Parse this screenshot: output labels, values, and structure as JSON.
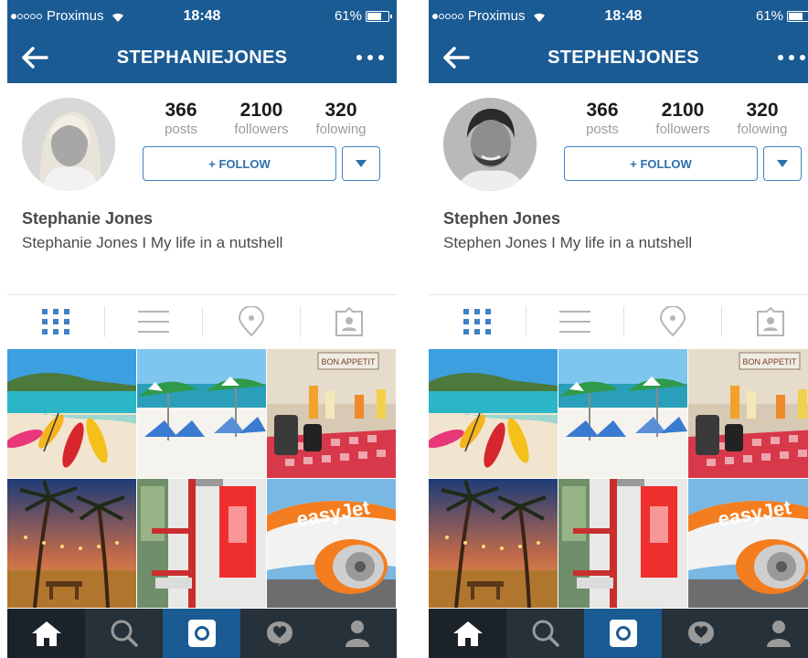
{
  "status_bar": {
    "carrier": "Proximus",
    "time": "18:48",
    "battery": "61%",
    "battery_level": 0.61
  },
  "colors": {
    "brand_blue": "#1b5b94",
    "accent_blue": "#3d82c4",
    "bottom_bar": "#26313a"
  },
  "profiles": [
    {
      "username": "STEPHANIEJONES",
      "stats": [
        {
          "value": "366",
          "label": "posts"
        },
        {
          "value": "2100",
          "label": "followers"
        },
        {
          "value": "320",
          "label": "folowing"
        }
      ],
      "follow_label": "+ FOLLOW",
      "full_name": "Stephanie Jones",
      "bio": "Stephanie Jones I My life in a nutshell",
      "avatar": "female-portrait"
    },
    {
      "username": "STEPHENJONES",
      "stats": [
        {
          "value": "366",
          "label": "posts"
        },
        {
          "value": "2100",
          "label": "followers"
        },
        {
          "value": "320",
          "label": "folowing"
        }
      ],
      "follow_label": "+ FOLLOW",
      "full_name": "Stephen Jones",
      "bio": "Stephen Jones I My life in a nutshell",
      "avatar": "male-portrait"
    }
  ],
  "profile_tabs": [
    "grid-icon",
    "list-icon",
    "location-pin-icon",
    "tagged-photo-icon"
  ],
  "photo_grid": [
    {
      "subject": "beach-kayaks-photo",
      "text": ""
    },
    {
      "subject": "beach-umbrellas-photo",
      "text": ""
    },
    {
      "subject": "breakfast-buffet-photo",
      "text": "BON APPETIT"
    },
    {
      "subject": "palm-sunset-photo",
      "text": ""
    },
    {
      "subject": "hostel-bunk-room-photo",
      "text": ""
    },
    {
      "subject": "easyjet-plane-photo",
      "text": "easyJet"
    }
  ],
  "bottom_nav": [
    "home-icon",
    "search-icon",
    "camera-icon",
    "activity-icon",
    "profile-icon"
  ]
}
